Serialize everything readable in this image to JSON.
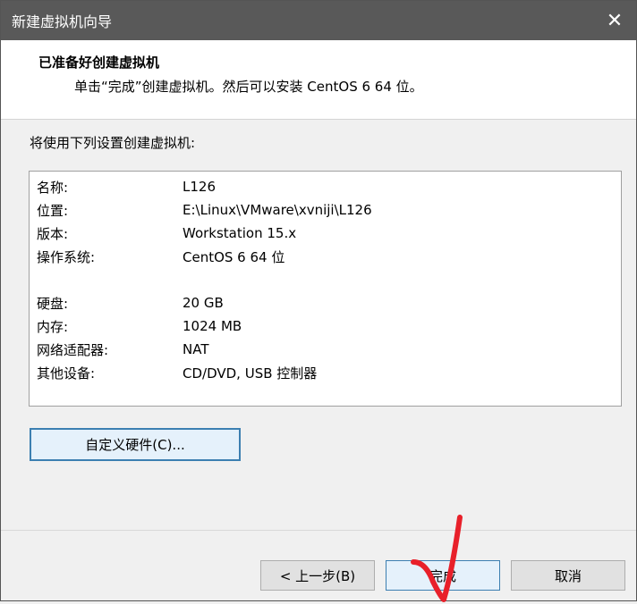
{
  "window": {
    "title": "新建虚拟机向导",
    "close_glyph": "✕"
  },
  "header": {
    "title": "已准备好创建虚拟机",
    "subtitle": "单击“完成”创建虚拟机。然后可以安装 CentOS 6 64 位。"
  },
  "intro": "将使用下列设置创建虚拟机:",
  "summary": [
    {
      "key": "名称:",
      "value": "L126"
    },
    {
      "key": "位置:",
      "value": "E:\\Linux\\VMware\\xvniji\\L126"
    },
    {
      "key": "版本:",
      "value": "Workstation 15.x"
    },
    {
      "key": "操作系统:",
      "value": "CentOS 6 64 位"
    },
    {
      "key": "硬盘:",
      "value": "20 GB"
    },
    {
      "key": "内存:",
      "value": "1024 MB"
    },
    {
      "key": "网络适配器:",
      "value": "NAT"
    },
    {
      "key": "其他设备:",
      "value": "CD/DVD, USB 控制器"
    }
  ],
  "buttons": {
    "customize": "自定义硬件(C)...",
    "back": "< 上一步(B)",
    "finish": "完成",
    "cancel": "取消"
  },
  "annotation": {
    "color": "#e8202a"
  }
}
